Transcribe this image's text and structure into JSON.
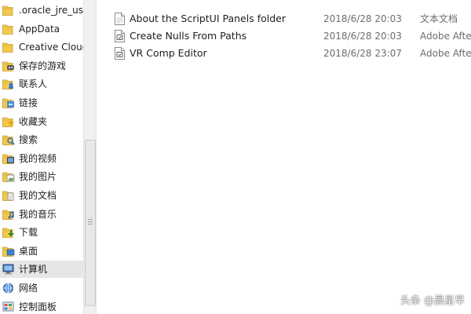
{
  "nav_items": [
    {
      "label": ".oracle_jre_usa",
      "icon": "folder-icon"
    },
    {
      "label": "AppData",
      "icon": "folder-icon"
    },
    {
      "label": "Creative Cloud",
      "icon": "folder-icon"
    },
    {
      "label": "保存的游戏",
      "icon": "saved-games-icon"
    },
    {
      "label": "联系人",
      "icon": "contacts-icon"
    },
    {
      "label": "链接",
      "icon": "links-icon"
    },
    {
      "label": "收藏夹",
      "icon": "favorites-icon"
    },
    {
      "label": "搜索",
      "icon": "searches-icon"
    },
    {
      "label": "我的视频",
      "icon": "videos-icon"
    },
    {
      "label": "我的图片",
      "icon": "pictures-icon"
    },
    {
      "label": "我的文档",
      "icon": "documents-icon"
    },
    {
      "label": "我的音乐",
      "icon": "music-icon"
    },
    {
      "label": "下载",
      "icon": "downloads-icon"
    },
    {
      "label": "桌面",
      "icon": "desktop-icon"
    },
    {
      "label": "计算机",
      "icon": "computer-icon"
    },
    {
      "label": "网络",
      "icon": "network-icon"
    },
    {
      "label": "控制面板",
      "icon": "control-panel-icon"
    }
  ],
  "selected_nav": "计算机",
  "files": [
    {
      "name": "About the ScriptUI Panels folder",
      "date": "2018/6/28 20:03",
      "type": "文本文档",
      "icon": "text-document-icon"
    },
    {
      "name": "Create Nulls From Paths",
      "date": "2018/6/28 20:03",
      "type": "Adobe After Effects",
      "icon": "script-file-icon"
    },
    {
      "name": "VR Comp Editor",
      "date": "2018/6/28 23:07",
      "type": "Adobe After Effects",
      "icon": "script-file-icon"
    }
  ],
  "watermark": "头条 @晨星早",
  "colors": {
    "folder": "#f2c94c",
    "selection": "#e6e6e6",
    "secondary_text": "#6d6d6d"
  }
}
